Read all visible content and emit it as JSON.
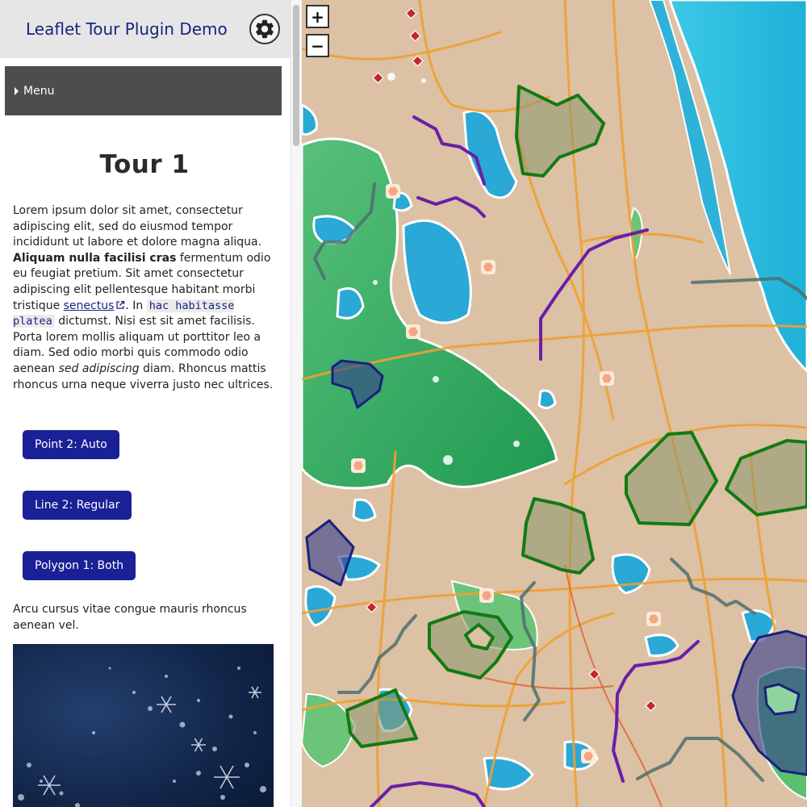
{
  "header": {
    "title": "Leaflet Tour Plugin Demo",
    "settings_icon": "gear-icon"
  },
  "menu": {
    "label": "Menu",
    "icon": "caret-right-icon"
  },
  "tour": {
    "title": "Tour 1",
    "para1": {
      "t1": "Lorem ipsum dolor sit amet, consectetur adipiscing elit, sed do eiusmod tempor incididunt ut labore et dolore magna aliqua. ",
      "bold": "Aliquam nulla facilisi cras",
      "t2": " fermentum odio eu feugiat pretium. Sit amet consectetur adipiscing elit pellentesque habitant morbi tristique ",
      "link": "senectus",
      "t3": ". In ",
      "code": "hac habitasse platea",
      "t4": " dictumst. Nisi est sit amet facilisis. Porta lorem mollis aliquam ut porttitor leo a diam. Sed odio morbi quis commodo odio aenean ",
      "italic": "sed adipiscing",
      "t5": " diam. Rhoncus mattis rhoncus urna neque viverra justo nec ultrices."
    },
    "buttons": [
      "Point 2: Auto",
      "Line 2: Regular",
      "Polygon 1: Both"
    ],
    "para2": "Arcu cursus vitae congue mauris rhoncus aenean vel."
  },
  "map": {
    "zoom_in": "+",
    "zoom_out": "−",
    "colors": {
      "land": "#dcc1a4",
      "ocean": "#2fbde0",
      "water": "#29a3d1",
      "forest": "#4cb56a",
      "road": "#f0a030",
      "line_purple": "#6a1ea8",
      "line_gray": "#4f6e6e",
      "poly_green": "#137a13",
      "poly_blue": "#1a2080",
      "marker_red": "#c62828",
      "marker_orange": "#f4a582"
    }
  }
}
